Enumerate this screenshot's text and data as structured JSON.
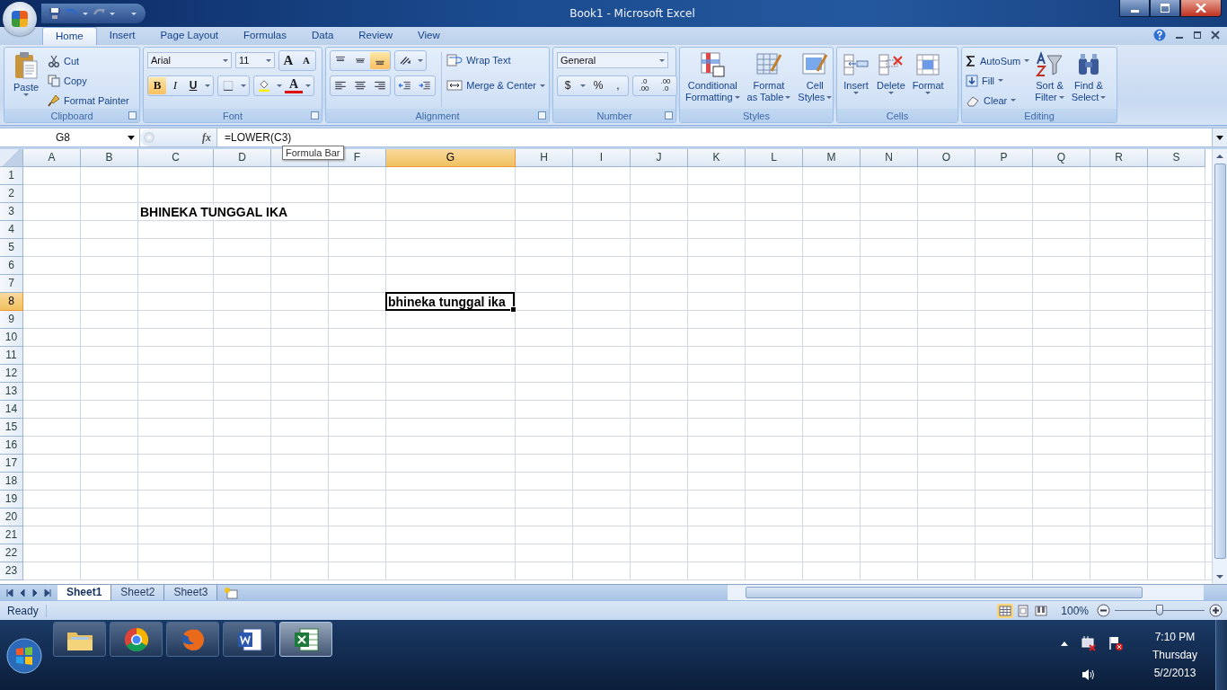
{
  "window": {
    "title": "Book1 - Microsoft Excel"
  },
  "tabs": [
    {
      "label": "Home",
      "selected": true
    },
    {
      "label": "Insert",
      "selected": false
    },
    {
      "label": "Page Layout",
      "selected": false
    },
    {
      "label": "Formulas",
      "selected": false
    },
    {
      "label": "Data",
      "selected": false
    },
    {
      "label": "Review",
      "selected": false
    },
    {
      "label": "View",
      "selected": false
    }
  ],
  "ribbon": {
    "clipboard": {
      "label": "Clipboard",
      "paste": "Paste",
      "cut": "Cut",
      "copy": "Copy",
      "format_painter": "Format Painter"
    },
    "font": {
      "label": "Font",
      "font_name": "Arial",
      "font_size": "11",
      "grow": "A",
      "shrink": "A",
      "bold": {
        "text": "B",
        "on": true
      },
      "italic": {
        "text": "I",
        "on": false
      },
      "underline": {
        "text": "U",
        "on": false
      },
      "font_color": "A"
    },
    "alignment": {
      "label": "Alignment",
      "wrap_text": "Wrap Text",
      "merge_center": "Merge & Center",
      "bottom_align": {
        "on": true
      }
    },
    "number": {
      "label": "Number",
      "format": "General",
      "currency": "$",
      "percent": "%",
      "comma": ",",
      "increase_decimal": [
        ".0",
        ".00"
      ],
      "decrease_decimal": [
        ".00",
        ".0"
      ]
    },
    "styles": {
      "label": "Styles",
      "conditional": [
        "Conditional",
        "Formatting"
      ],
      "format_table": [
        "Format",
        "as Table"
      ],
      "cell_styles": [
        "Cell",
        "Styles"
      ]
    },
    "cells": {
      "label": "Cells",
      "insert": "Insert",
      "delete": "Delete",
      "format": "Format"
    },
    "editing": {
      "label": "Editing",
      "autosum": "AutoSum",
      "fill": "Fill",
      "clear": "Clear",
      "sort": [
        "Sort &",
        "Filter"
      ],
      "find": [
        "Find &",
        "Select"
      ]
    }
  },
  "formula_bar": {
    "name_box": "G8",
    "function_label": "fx",
    "formula": "=LOWER(C3)",
    "tooltip": "Formula Bar"
  },
  "columns": [
    {
      "label": "A",
      "selected": false
    },
    {
      "label": "B",
      "selected": false
    },
    {
      "label": "C",
      "selected": false
    },
    {
      "label": "D",
      "selected": false
    },
    {
      "selected": false
    },
    {
      "label": "F",
      "selected": false
    },
    {
      "label": "G",
      "selected": true
    },
    {
      "label": "H",
      "selected": false
    },
    {
      "label": "I",
      "selected": false
    },
    {
      "label": "J",
      "selected": false
    },
    {
      "label": "K",
      "selected": false
    },
    {
      "label": "L",
      "selected": false
    },
    {
      "label": "M",
      "selected": false
    },
    {
      "label": "N",
      "selected": false
    },
    {
      "label": "O",
      "selected": false
    },
    {
      "label": "P",
      "selected": false
    },
    {
      "label": "Q",
      "selected": false
    },
    {
      "label": "R",
      "selected": false
    },
    {
      "label": "S",
      "selected": false
    }
  ],
  "rows": [
    {
      "label": "1",
      "selected": false
    },
    {
      "label": "2",
      "selected": false
    },
    {
      "label": "3",
      "selected": false,
      "cells": {
        "C": {
          "text": "BHINEKA TUNGGAL IKA",
          "bold": true,
          "selected": false
        }
      }
    },
    {
      "label": "4",
      "selected": false
    },
    {
      "label": "5",
      "selected": false
    },
    {
      "label": "6",
      "selected": false
    },
    {
      "label": "7",
      "selected": false
    },
    {
      "label": "8",
      "selected": true,
      "cells": {
        "G": {
          "text": "bhineka tunggal ika",
          "bold": true,
          "selected": true
        }
      }
    },
    {
      "label": "9",
      "selected": false
    },
    {
      "label": "10",
      "selected": false
    },
    {
      "label": "11",
      "selected": false
    },
    {
      "label": "12",
      "selected": false
    },
    {
      "label": "13",
      "selected": false
    },
    {
      "label": "14",
      "selected": false
    },
    {
      "label": "15",
      "selected": false
    },
    {
      "label": "16",
      "selected": false
    },
    {
      "label": "17",
      "selected": false
    },
    {
      "label": "18",
      "selected": false
    },
    {
      "label": "19",
      "selected": false
    },
    {
      "label": "20",
      "selected": false
    },
    {
      "label": "21",
      "selected": false
    },
    {
      "label": "22",
      "selected": false
    },
    {
      "label": "23",
      "selected": false
    }
  ],
  "sheets": [
    {
      "label": "Sheet1",
      "selected": true
    },
    {
      "label": "Sheet2",
      "selected": false
    },
    {
      "label": "Sheet3",
      "selected": false
    }
  ],
  "status": {
    "text": "Ready",
    "zoom": "100%",
    "zoom_slider": {
      "level": 0.5
    },
    "views": [
      {
        "kind": "normal",
        "selected": true
      },
      {
        "kind": "page-layout",
        "selected": false
      },
      {
        "kind": "page-break",
        "selected": false
      }
    ]
  },
  "taskbar": {
    "apps": [
      {
        "kind": "folder",
        "selected": false
      },
      {
        "kind": "chrome",
        "selected": false
      },
      {
        "kind": "fox",
        "selected": false
      },
      {
        "kind": "word",
        "selected": false
      },
      {
        "kind": "excel",
        "selected": true
      }
    ],
    "time": "7:10 PM",
    "day": "Thursday",
    "date": "5/2/2013"
  }
}
